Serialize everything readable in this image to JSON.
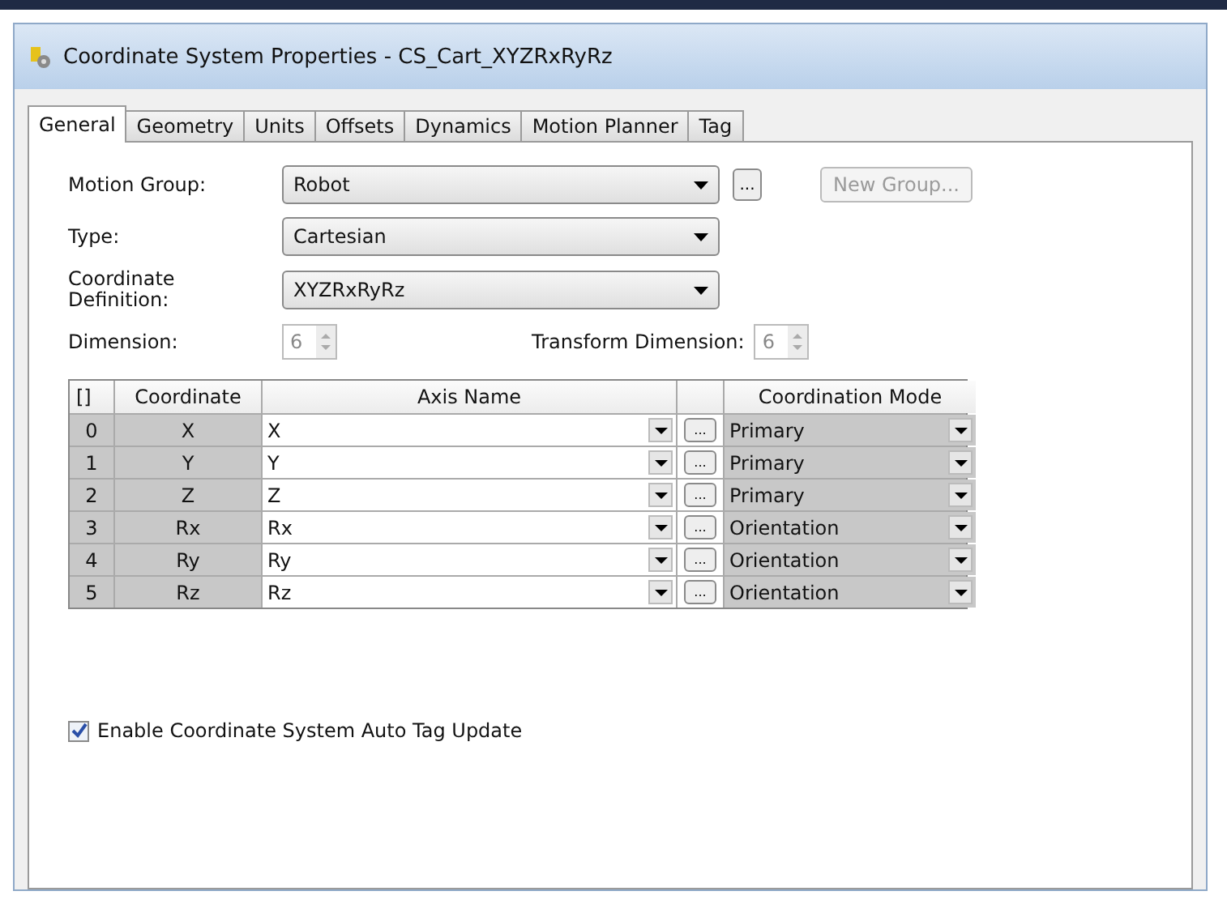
{
  "window": {
    "title": "Coordinate System Properties - CS_Cart_XYZRxRyRz"
  },
  "tabs": [
    {
      "label": "General",
      "selected": true
    },
    {
      "label": "Geometry",
      "selected": false
    },
    {
      "label": "Units",
      "selected": false
    },
    {
      "label": "Offsets",
      "selected": false
    },
    {
      "label": "Dynamics",
      "selected": false
    },
    {
      "label": "Motion Planner",
      "selected": false
    },
    {
      "label": "Tag",
      "selected": false
    }
  ],
  "motion_group": {
    "label": "Motion Group:",
    "value": "Robot",
    "browse": "...",
    "new_group": {
      "label": "New Group...",
      "disabled": true
    }
  },
  "type": {
    "label": "Type:",
    "value": "Cartesian"
  },
  "coordinate_definition": {
    "label": "Coordinate Definition:",
    "value": "XYZRxRyRz"
  },
  "dimension": {
    "label": "Dimension:",
    "value": "6",
    "disabled": true
  },
  "transform_dimension": {
    "label": "Transform Dimension:",
    "value": "6",
    "disabled": true
  },
  "table": {
    "columns": [
      "[]",
      "Coordinate",
      "Axis Name",
      "Coordination Mode"
    ],
    "rows": [
      {
        "index": "0",
        "coordinate": "X",
        "axis_name": "X",
        "browse": "...",
        "mode": "Primary"
      },
      {
        "index": "1",
        "coordinate": "Y",
        "axis_name": "Y",
        "browse": "...",
        "mode": "Primary"
      },
      {
        "index": "2",
        "coordinate": "Z",
        "axis_name": "Z",
        "browse": "...",
        "mode": "Primary"
      },
      {
        "index": "3",
        "coordinate": "Rx",
        "axis_name": "Rx",
        "browse": "...",
        "mode": "Orientation"
      },
      {
        "index": "4",
        "coordinate": "Ry",
        "axis_name": "Ry",
        "browse": "...",
        "mode": "Orientation"
      },
      {
        "index": "5",
        "coordinate": "Rz",
        "axis_name": "Rz",
        "browse": "...",
        "mode": "Orientation"
      }
    ]
  },
  "auto_tag_update": {
    "label": "Enable Coordinate System Auto Tag Update",
    "checked": true
  }
}
